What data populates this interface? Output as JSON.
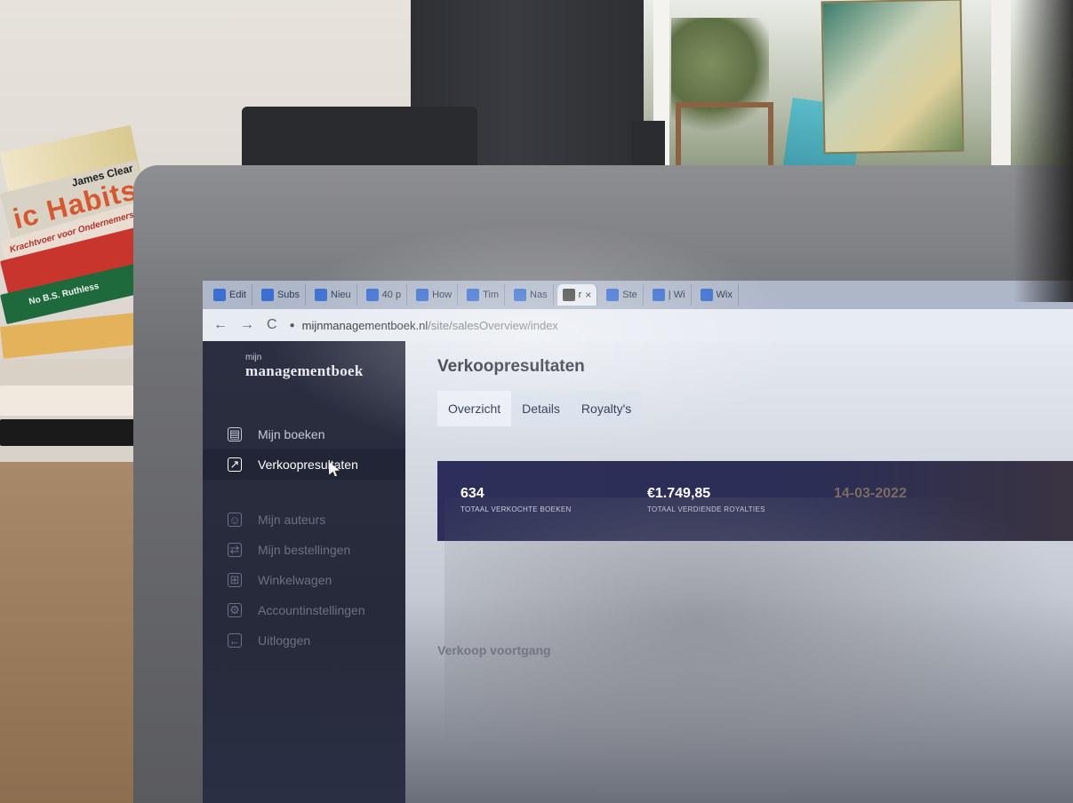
{
  "photo": {
    "books": {
      "habits_title": "ic Habits",
      "habits_author": "James Clear",
      "krachtvoer": "Krachtvoer voor Ondernemers",
      "no_bs": "No B.S. Ruthless"
    }
  },
  "browser": {
    "tabs": [
      {
        "label": "Edit",
        "active": false
      },
      {
        "label": "Subs",
        "active": false
      },
      {
        "label": "Nieu",
        "active": false
      },
      {
        "label": "40 p",
        "active": false
      },
      {
        "label": "How",
        "active": false
      },
      {
        "label": "Tim",
        "active": false
      },
      {
        "label": "Nas",
        "active": false
      },
      {
        "label": "r",
        "active": true
      },
      {
        "label": "Ste",
        "active": false
      },
      {
        "label": "| Wi",
        "active": false
      },
      {
        "label": "Wix",
        "active": false
      }
    ],
    "tab_close": "×",
    "nav": {
      "back": "←",
      "forward": "→",
      "reload": "C"
    },
    "url_domain": "mijnmanagementboek.nl",
    "url_path": "/site/salesOverview/index"
  },
  "sidebar": {
    "brand_small": "mijn",
    "brand_big": "managementboek",
    "items": [
      {
        "label": "Mijn boeken",
        "icon": "book-icon",
        "glyph": "▤",
        "state": "normal"
      },
      {
        "label": "Verkoopresultaten",
        "icon": "chart-icon",
        "glyph": "↗",
        "state": "active"
      },
      {
        "label": "Mijn auteurs",
        "icon": "user-icon",
        "glyph": "☺",
        "state": "dim"
      },
      {
        "label": "Mijn bestellingen",
        "icon": "orders-icon",
        "glyph": "⇄",
        "state": "dim"
      },
      {
        "label": "Winkelwagen",
        "icon": "cart-icon",
        "glyph": "⊞",
        "state": "dim"
      },
      {
        "label": "Accountinstellingen",
        "icon": "settings-icon",
        "glyph": "⚙",
        "state": "dim"
      },
      {
        "label": "Uitloggen",
        "icon": "logout-icon",
        "glyph": "←",
        "state": "dim"
      }
    ]
  },
  "main": {
    "title": "Verkoopresultaten",
    "tabs": [
      {
        "label": "Overzicht",
        "active": true
      },
      {
        "label": "Details",
        "active": false
      },
      {
        "label": "Royalty's",
        "active": false
      }
    ],
    "stats": [
      {
        "value": "634",
        "label": "TOTAAL VERKOCHTE BOEKEN",
        "faded": false
      },
      {
        "value": "€1.749,85",
        "label": "TOTAAL VERDIENDE ROYALTIES",
        "faded": false
      },
      {
        "value": "14-03-2022",
        "label": "",
        "faded": true
      }
    ],
    "section_title": "Verkoop voortgang"
  },
  "colors": {
    "sidebar_bg": "#2a2e40",
    "stats_bg": "#2c2f59",
    "accent_text": "#1d2a46"
  }
}
